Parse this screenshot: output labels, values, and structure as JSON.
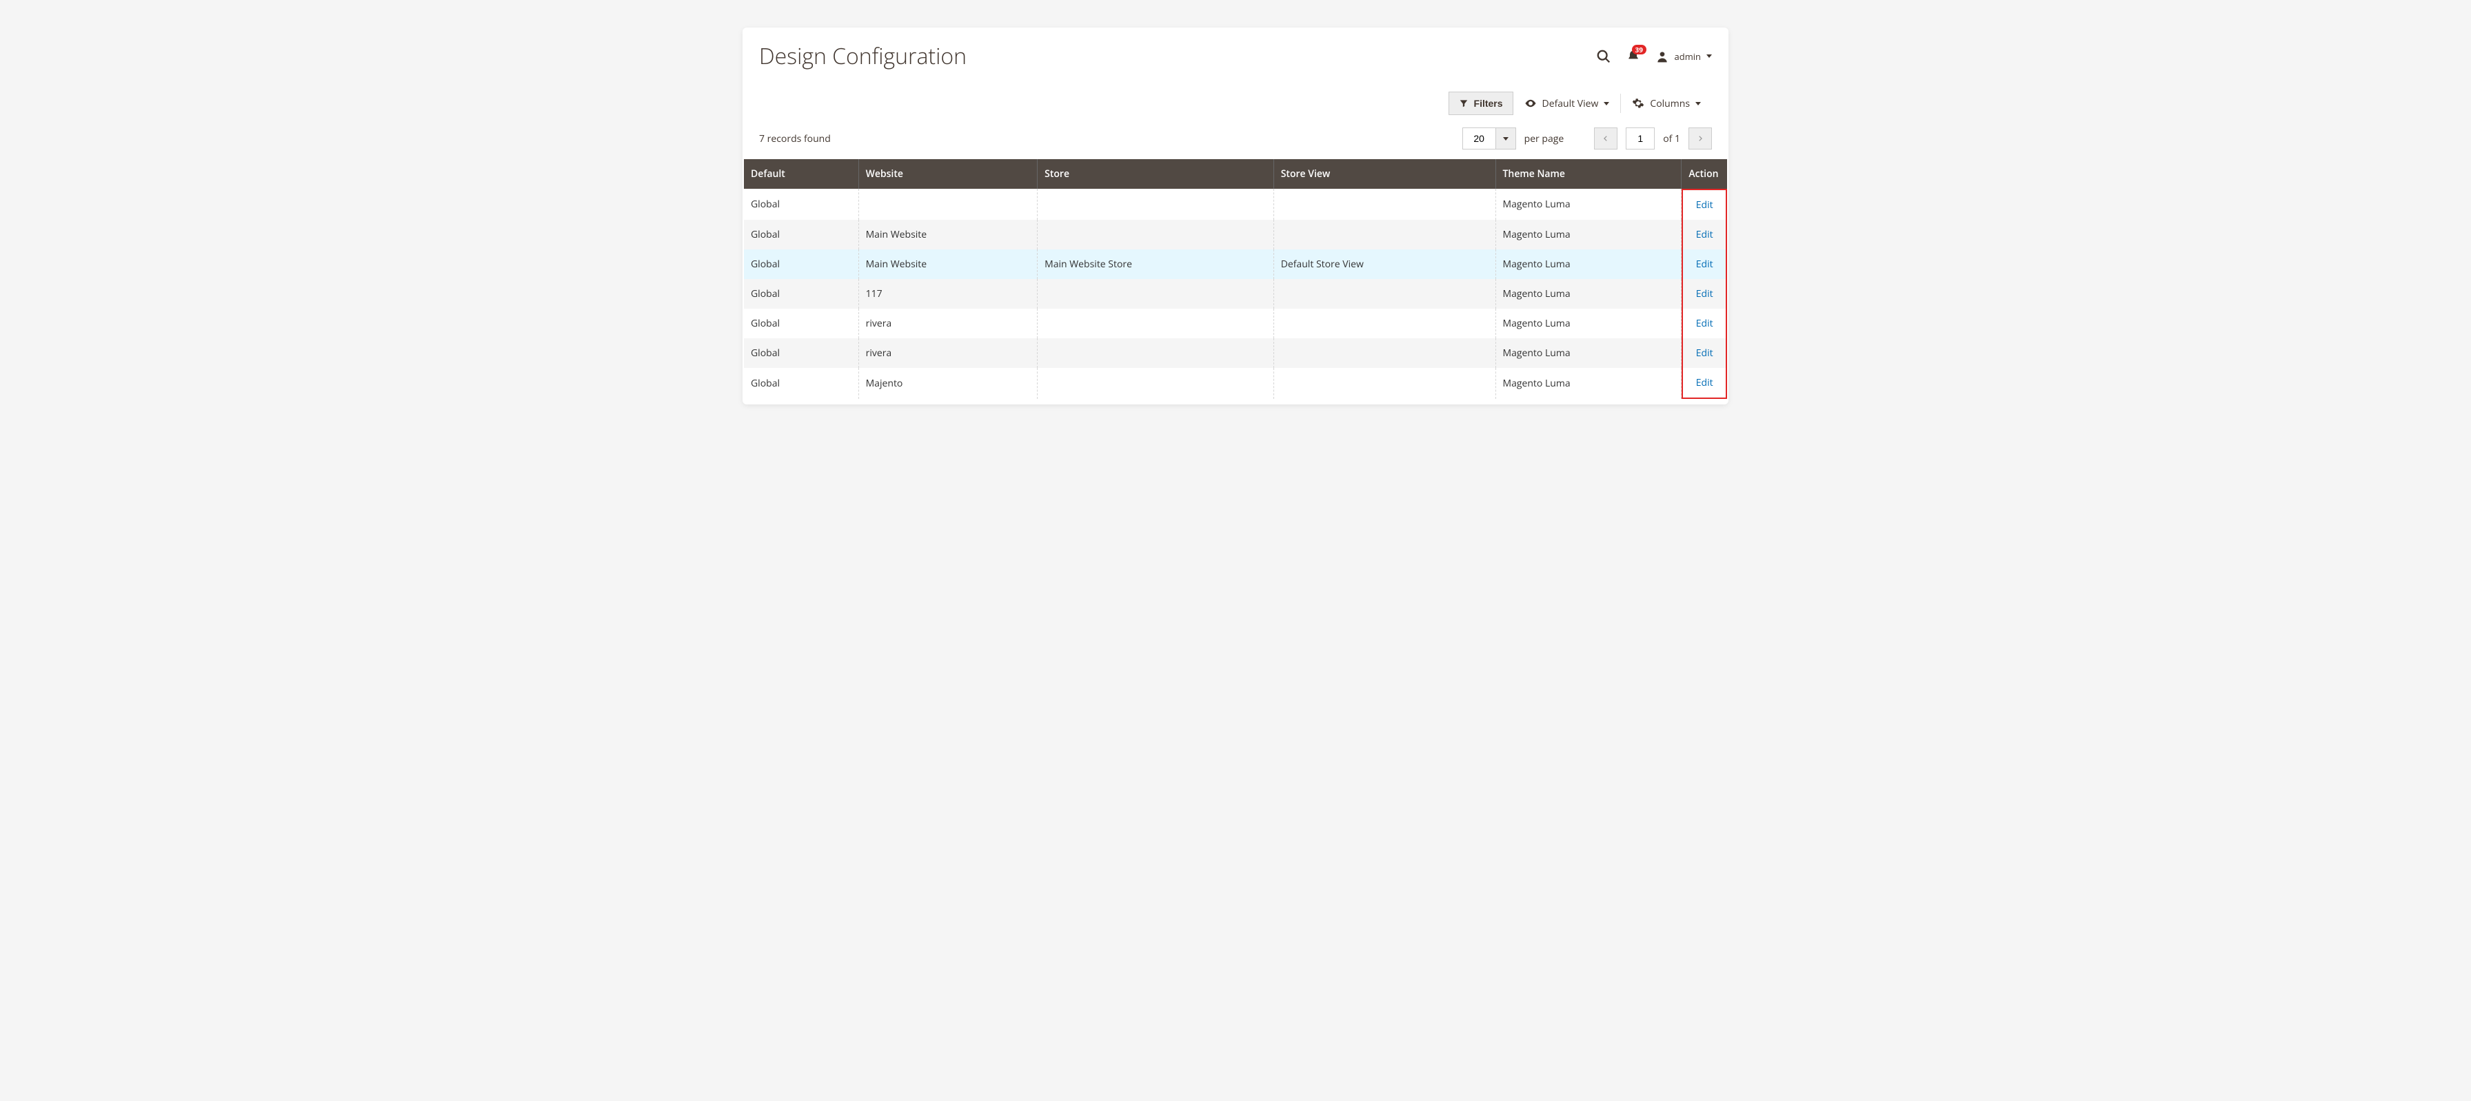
{
  "page_title": "Design Configuration",
  "notifications_count": "39",
  "username": "admin",
  "toolbar": {
    "filters_label": "Filters",
    "default_view_label": "Default View",
    "columns_label": "Columns"
  },
  "records_found_text": "7 records found",
  "pagination": {
    "per_page_value": "20",
    "per_page_label": "per page",
    "current_page": "1",
    "of_label": "of 1"
  },
  "columns": {
    "default": "Default",
    "website": "Website",
    "store": "Store",
    "store_view": "Store View",
    "theme_name": "Theme Name",
    "action": "Action"
  },
  "edit_label": "Edit",
  "rows": [
    {
      "default": "Global",
      "website": "",
      "store": "",
      "store_view": "",
      "theme": "Magento Luma",
      "highlight": false
    },
    {
      "default": "Global",
      "website": "Main Website",
      "store": "",
      "store_view": "",
      "theme": "Magento Luma",
      "highlight": false
    },
    {
      "default": "Global",
      "website": "Main Website",
      "store": "Main Website Store",
      "store_view": "Default Store View",
      "theme": "Magento Luma",
      "highlight": true
    },
    {
      "default": "Global",
      "website": "117",
      "store": "",
      "store_view": "",
      "theme": "Magento Luma",
      "highlight": false
    },
    {
      "default": "Global",
      "website": "rivera",
      "store": "",
      "store_view": "",
      "theme": "Magento Luma",
      "highlight": false
    },
    {
      "default": "Global",
      "website": "rivera",
      "store": "",
      "store_view": "",
      "theme": "Magento Luma",
      "highlight": false
    },
    {
      "default": "Global",
      "website": "Majento",
      "store": "",
      "store_view": "",
      "theme": "Magento Luma",
      "highlight": false
    }
  ]
}
